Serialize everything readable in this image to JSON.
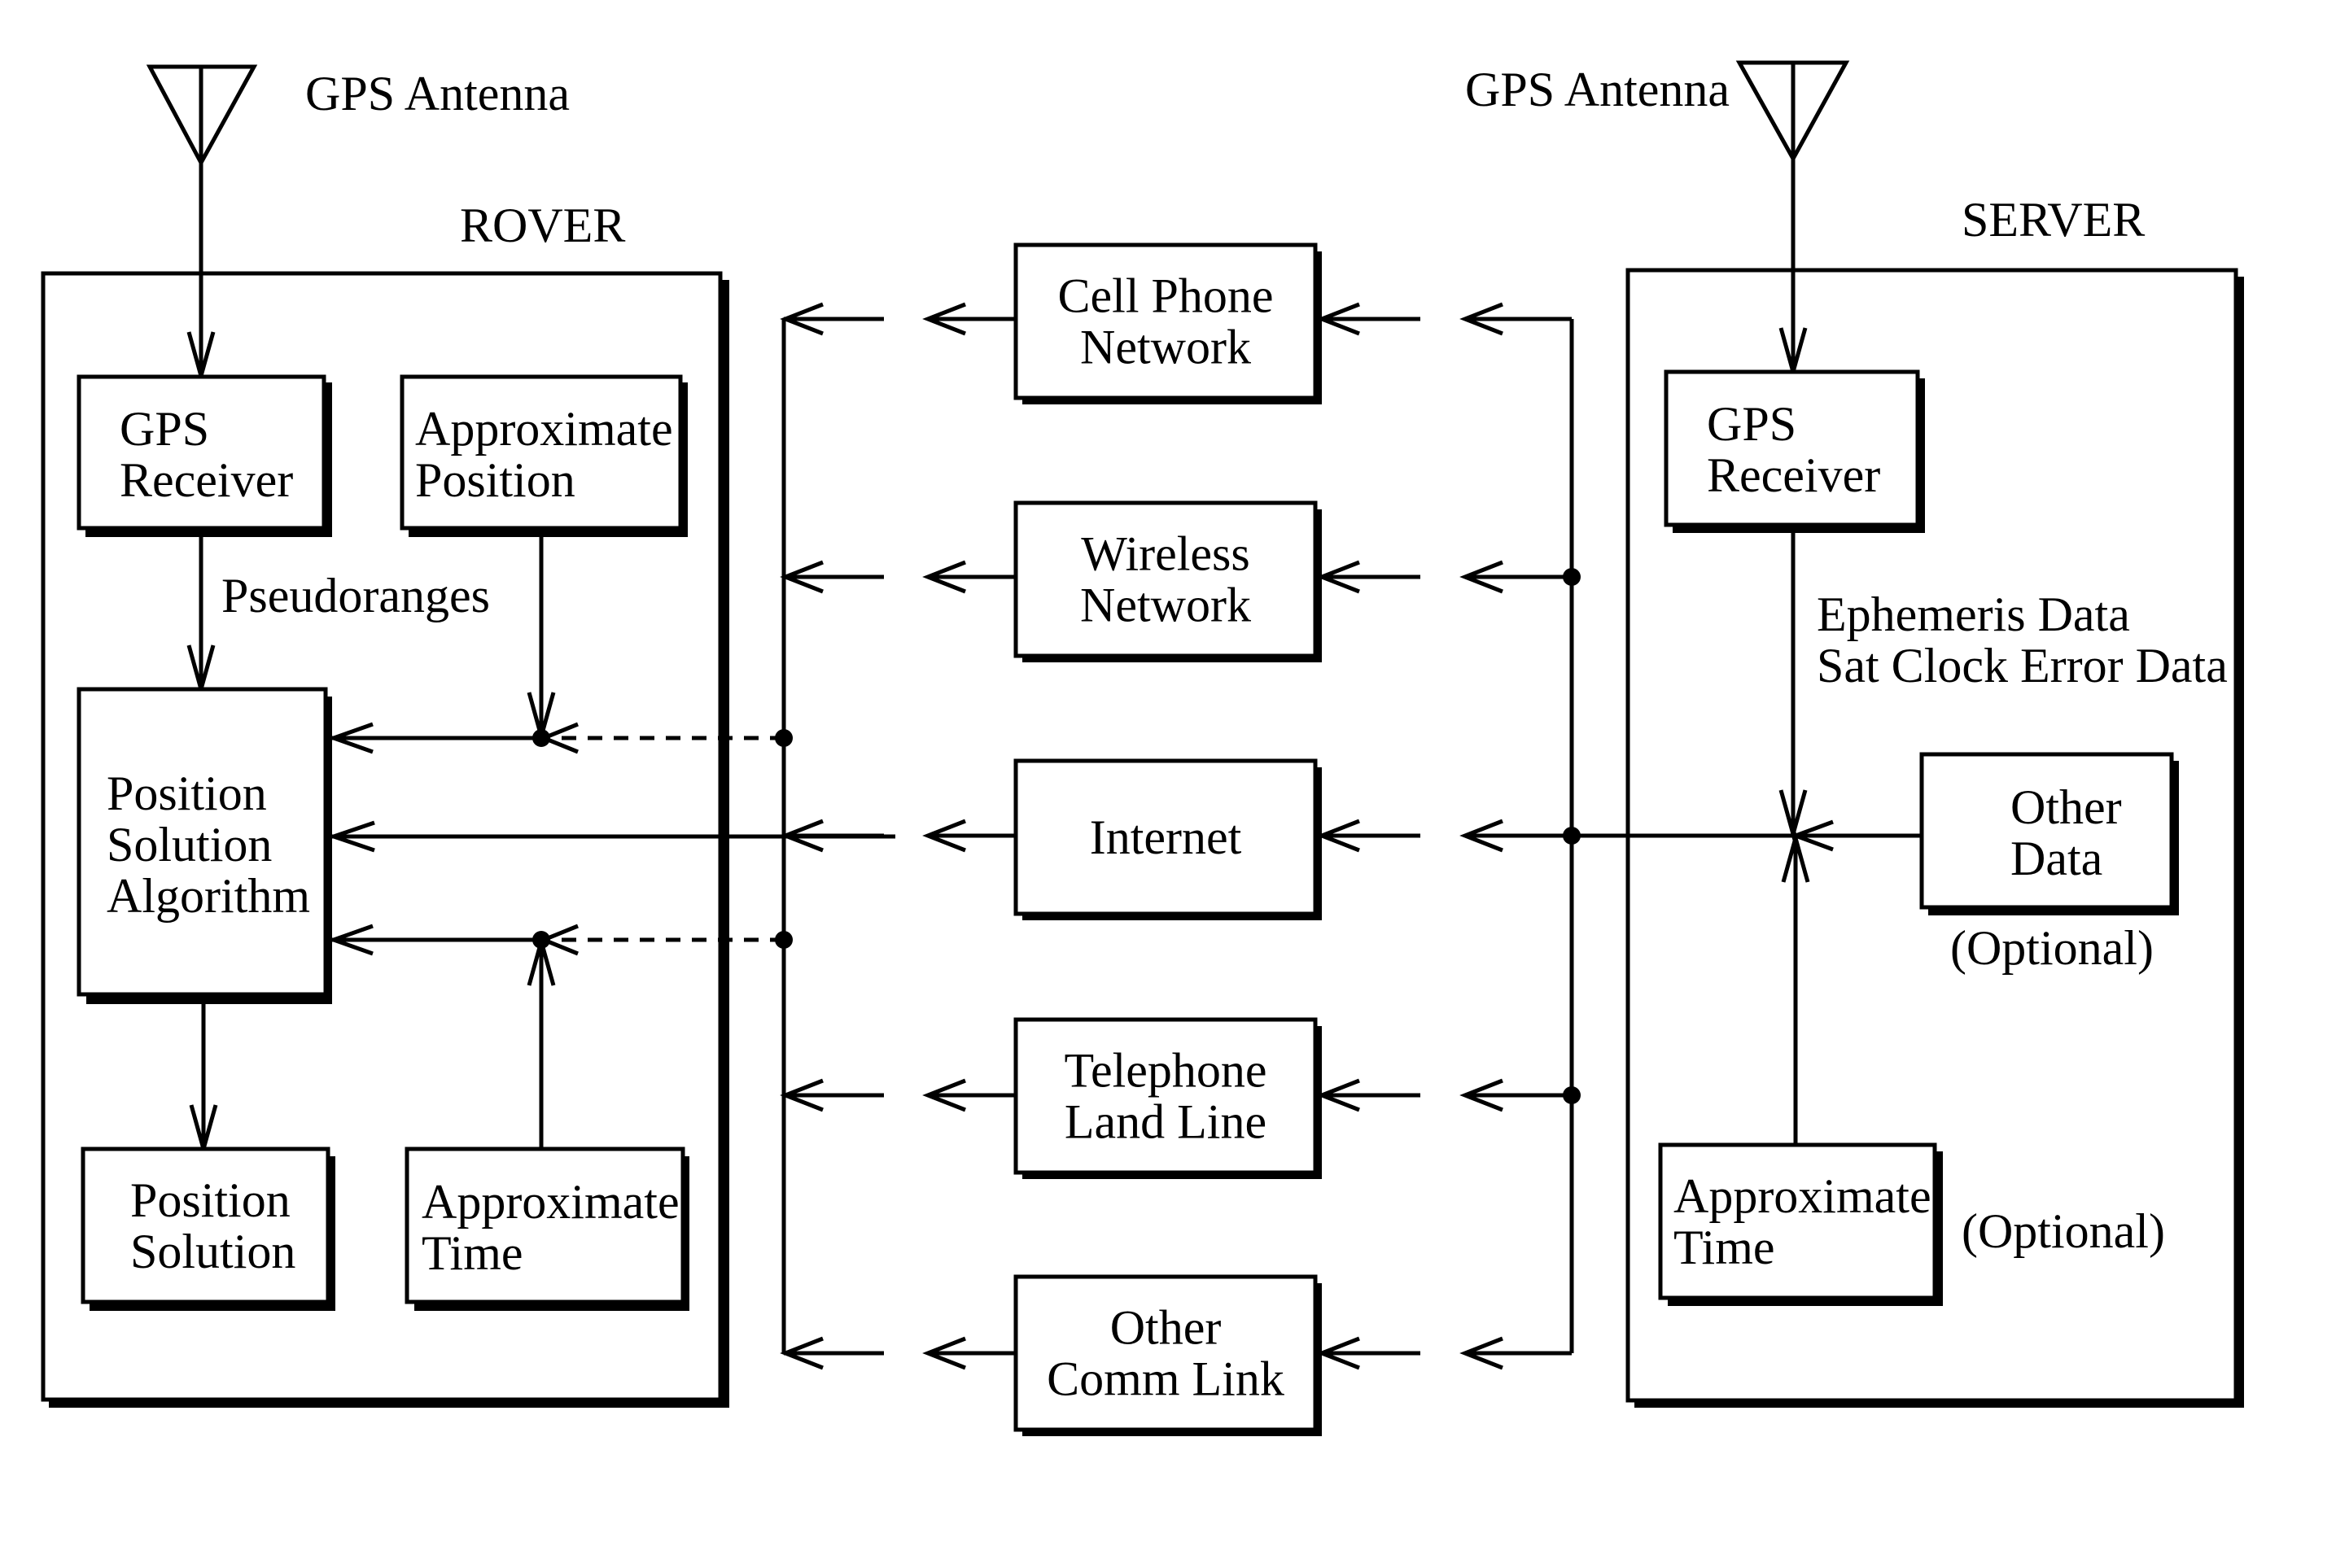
{
  "diagram": {
    "title_left": "ROVER",
    "title_right": "SERVER",
    "colors": {
      "ink": "#000000",
      "background": "#ffffff"
    },
    "rover": {
      "antenna_label": "GPS Antenna",
      "gps_receiver": [
        "GPS",
        "Receiver"
      ],
      "approximate_position": [
        "Approximate",
        "Position"
      ],
      "pseudoranges_label": "Pseudoranges",
      "position_solution_algorithm": [
        "Position",
        "Solution",
        "Algorithm"
      ],
      "position_solution": [
        "Position",
        "Solution"
      ],
      "approximate_time": [
        "Approximate",
        "Time"
      ]
    },
    "links": [
      {
        "id": "cell",
        "label": [
          "Cell Phone",
          "Network"
        ]
      },
      {
        "id": "wireless",
        "label": [
          "Wireless",
          "Network"
        ]
      },
      {
        "id": "internet",
        "label": [
          "Internet"
        ]
      },
      {
        "id": "telephone",
        "label": [
          "Telephone",
          "Land Line"
        ]
      },
      {
        "id": "other",
        "label": [
          "Other",
          "Comm Link"
        ]
      }
    ],
    "server": {
      "antenna_label": "GPS Antenna",
      "gps_receiver": [
        "GPS",
        "Receiver"
      ],
      "data_label": [
        "Ephemeris Data",
        "Sat Clock Error Data"
      ],
      "other_data": [
        "Other",
        "Data"
      ],
      "other_data_note": "(Optional)",
      "approximate_time": [
        "Approximate",
        "Time"
      ],
      "approximate_time_note": "(Optional)"
    }
  }
}
